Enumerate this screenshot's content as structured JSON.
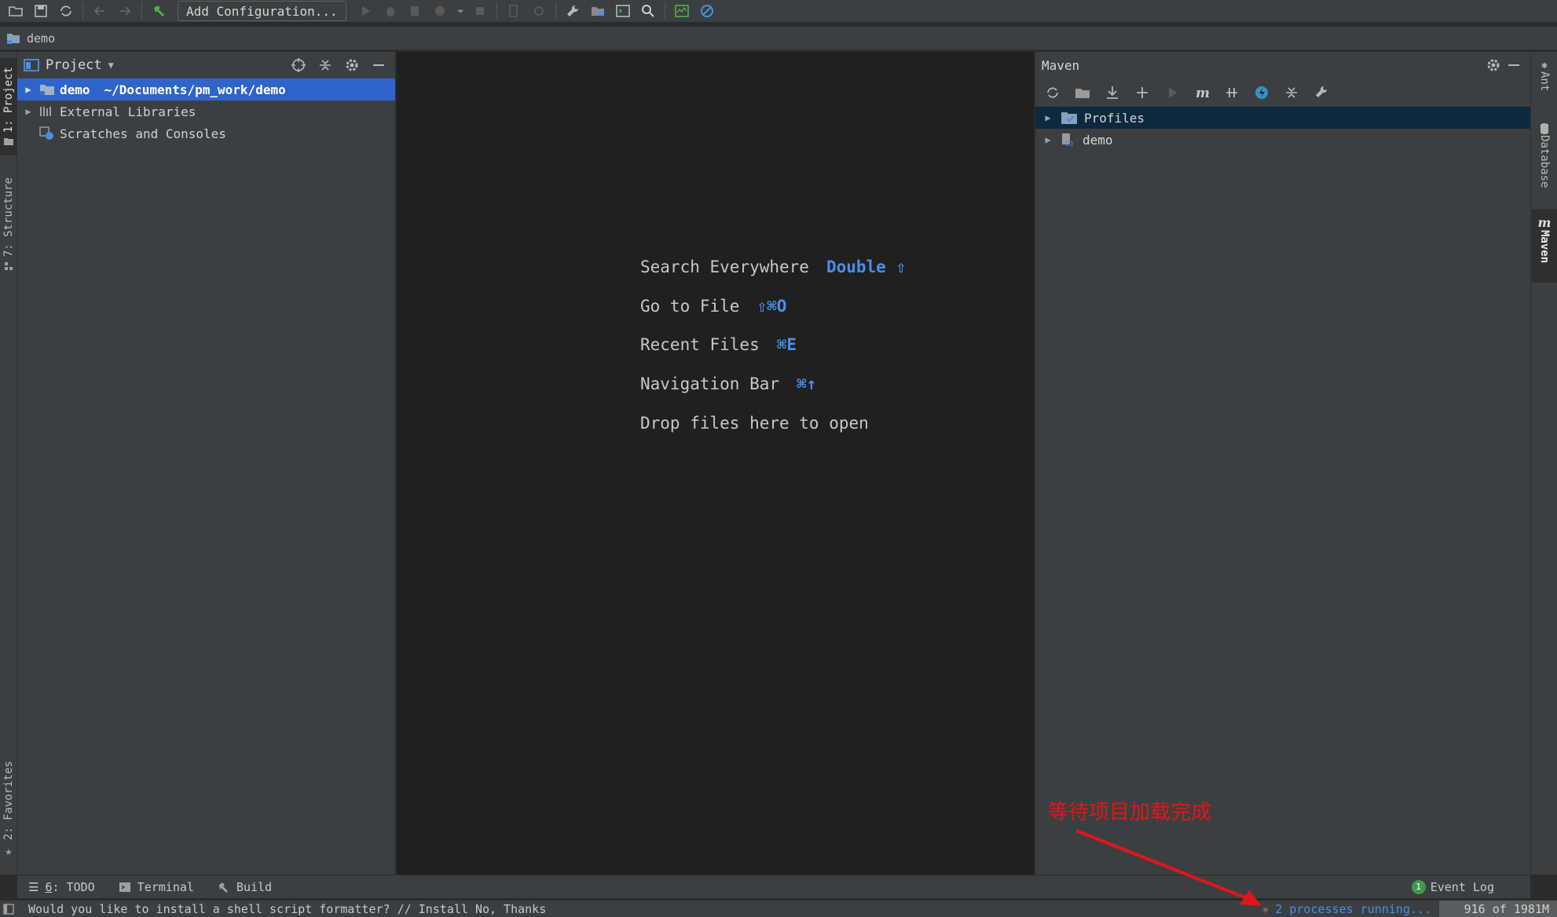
{
  "toolbar": {
    "add_configuration_label": "Add Configuration..."
  },
  "breadcrumb": {
    "project_name": "demo"
  },
  "left_stripe": {
    "project_tab": "1: Project",
    "structure_tab": "7: Structure",
    "favorites_tab": "2: Favorites"
  },
  "project_panel": {
    "title": "Project",
    "tree": [
      {
        "name": "demo",
        "path": "~/Documents/pm_work/demo",
        "selected": true,
        "expandable": true
      },
      {
        "name": "External Libraries",
        "expandable": true
      },
      {
        "name": "Scratches and Consoles",
        "expandable": false
      }
    ]
  },
  "editor": {
    "hints": [
      {
        "label": "Search Everywhere",
        "shortcut": "Double ⇧"
      },
      {
        "label": "Go to File",
        "shortcut": "⇧⌘O"
      },
      {
        "label": "Recent Files",
        "shortcut": "⌘E"
      },
      {
        "label": "Navigation Bar",
        "shortcut": "⌘↑"
      },
      {
        "label": "Drop files here to open",
        "shortcut": ""
      }
    ]
  },
  "maven_panel": {
    "title": "Maven",
    "tree": [
      {
        "name": "Profiles"
      },
      {
        "name": "demo"
      }
    ]
  },
  "right_stripe": {
    "ant_tab": "Ant",
    "database_tab": "Database",
    "maven_tab": "Maven"
  },
  "bottom_tabs": {
    "todo_number": "6",
    "todo_label": ": TODO",
    "terminal_label": "Terminal",
    "build_label": "Build",
    "event_log_count": "1",
    "event_log_label": "Event Log"
  },
  "status_bar": {
    "message": "Would you like to install a shell script formatter? // Install   No, Thanks",
    "processes": "2 processes running...",
    "memory": "916 of 1981M"
  },
  "annotation": {
    "text": "等待项目加载完成",
    "color": "#e0161b"
  },
  "colors": {
    "selection": "#2f65ca",
    "link_blue": "#4a8fe7",
    "editor_bg": "#202020",
    "panel_bg": "#3c3f41"
  }
}
